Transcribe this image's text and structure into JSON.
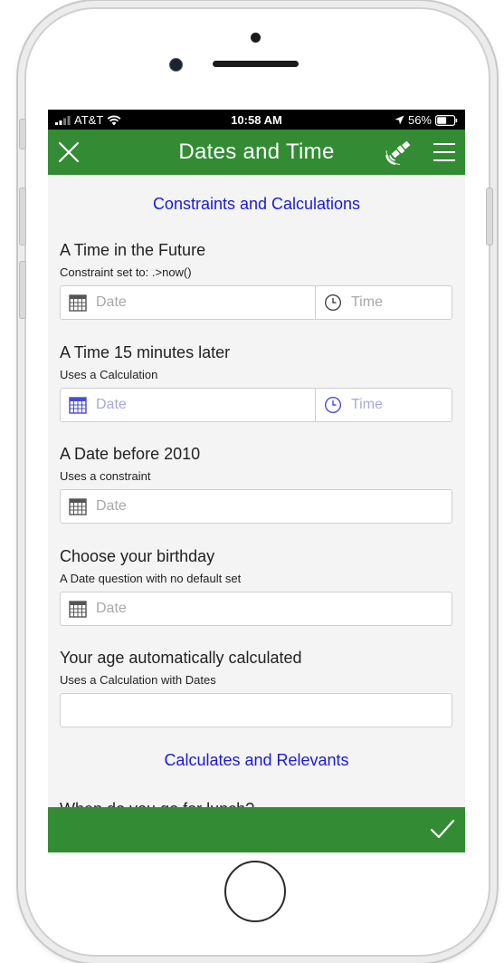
{
  "status_bar": {
    "carrier": "AT&T",
    "time": "10:58 AM",
    "battery": "56%",
    "battery_level": 0.56
  },
  "app_bar": {
    "title": "Dates and Time"
  },
  "sections": {
    "constraints": "Constraints and Calculations",
    "calculates": "Calculates and Relevants"
  },
  "questions": [
    {
      "title": "A Time in the Future",
      "hint": "Constraint set to: .>now()",
      "date_placeholder": "Date",
      "time_placeholder": "Time"
    },
    {
      "title": "A Time 15 minutes later",
      "hint": "Uses a Calculation",
      "date_placeholder": "Date",
      "time_placeholder": "Time"
    },
    {
      "title": "A Date before 2010",
      "hint": "Uses a constraint",
      "date_placeholder": "Date"
    },
    {
      "title": "Choose your birthday",
      "hint": "A Date question with no default set",
      "date_placeholder": "Date"
    },
    {
      "title": "Your age automatically calculated",
      "hint": "Uses a Calculation with Dates",
      "value": ""
    }
  ],
  "partial_question": "When do you go for lunch?",
  "icons": {
    "close": "close-icon",
    "gps": "satellite-icon",
    "menu": "hamburger-menu-icon",
    "calendar": "calendar-icon",
    "clock": "clock-icon",
    "submit": "checkmark-icon"
  },
  "colors": {
    "app_bar": "#338c33",
    "section_header": "#1a1adf",
    "placeholder_disabled": "#a9a9dc"
  }
}
